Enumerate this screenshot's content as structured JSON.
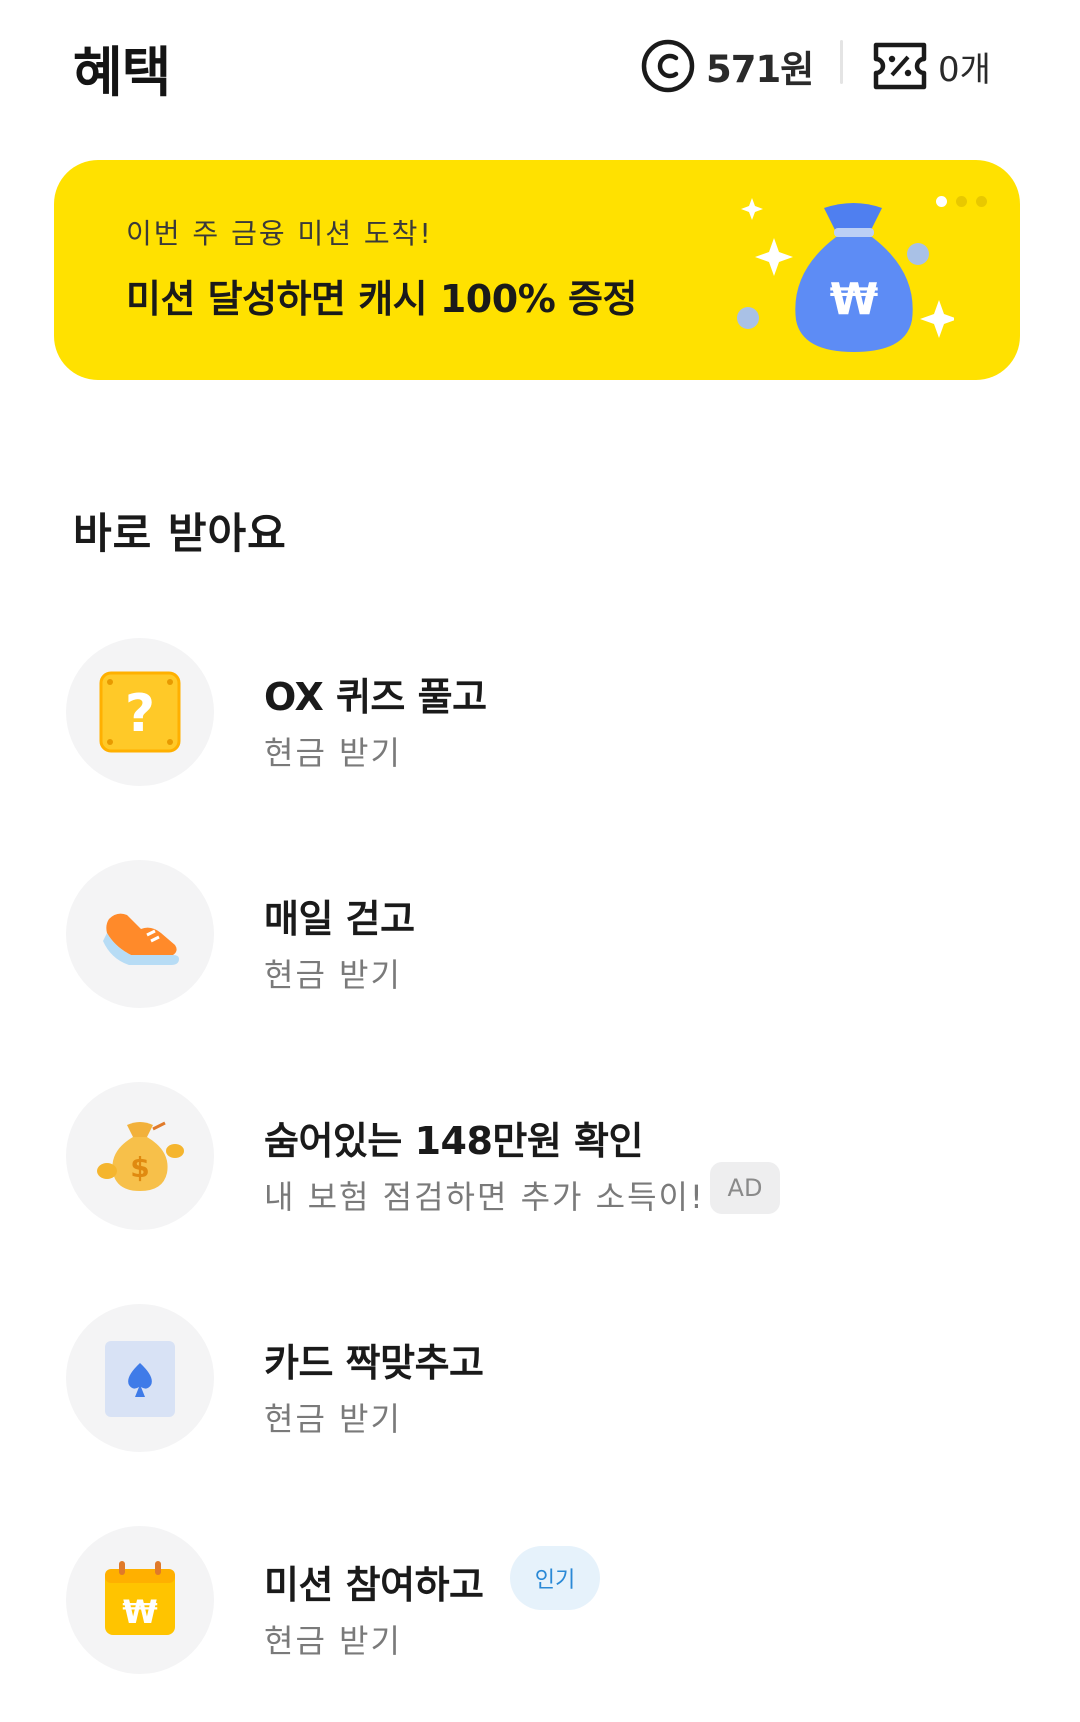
{
  "header": {
    "title": "혜택",
    "points_icon": "copyright-coin-icon",
    "points_value": "571원",
    "coupon_icon": "coupon-ticket-icon",
    "coupon_count": "0개"
  },
  "banner": {
    "subtitle": "이번 주 금융 미션 도착!",
    "title": "미션 달성하면 캐시 100% 증정",
    "art_icon": "money-bag-won-icon",
    "bg_color": "#ffe100",
    "pager": {
      "count": 3,
      "active_index": 0
    }
  },
  "section": {
    "title": "바로 받아요"
  },
  "items": [
    {
      "icon": "question-box-icon",
      "title": "OX 퀴즈 풀고",
      "subtitle": "현금 받기"
    },
    {
      "icon": "sneaker-icon",
      "title": "매일 걷고",
      "subtitle": "현금 받기"
    },
    {
      "icon": "money-bag-coins-icon",
      "title": "숨어있는 148만원 확인",
      "subtitle": "내 보험 점검하면 추가 소득이!",
      "badge": "AD"
    },
    {
      "icon": "spade-card-icon",
      "title": "카드 짝맞추고",
      "subtitle": "현금 받기"
    },
    {
      "icon": "won-calendar-icon",
      "title": "미션 참여하고",
      "subtitle": "현금 받기",
      "badge": "인기"
    }
  ]
}
